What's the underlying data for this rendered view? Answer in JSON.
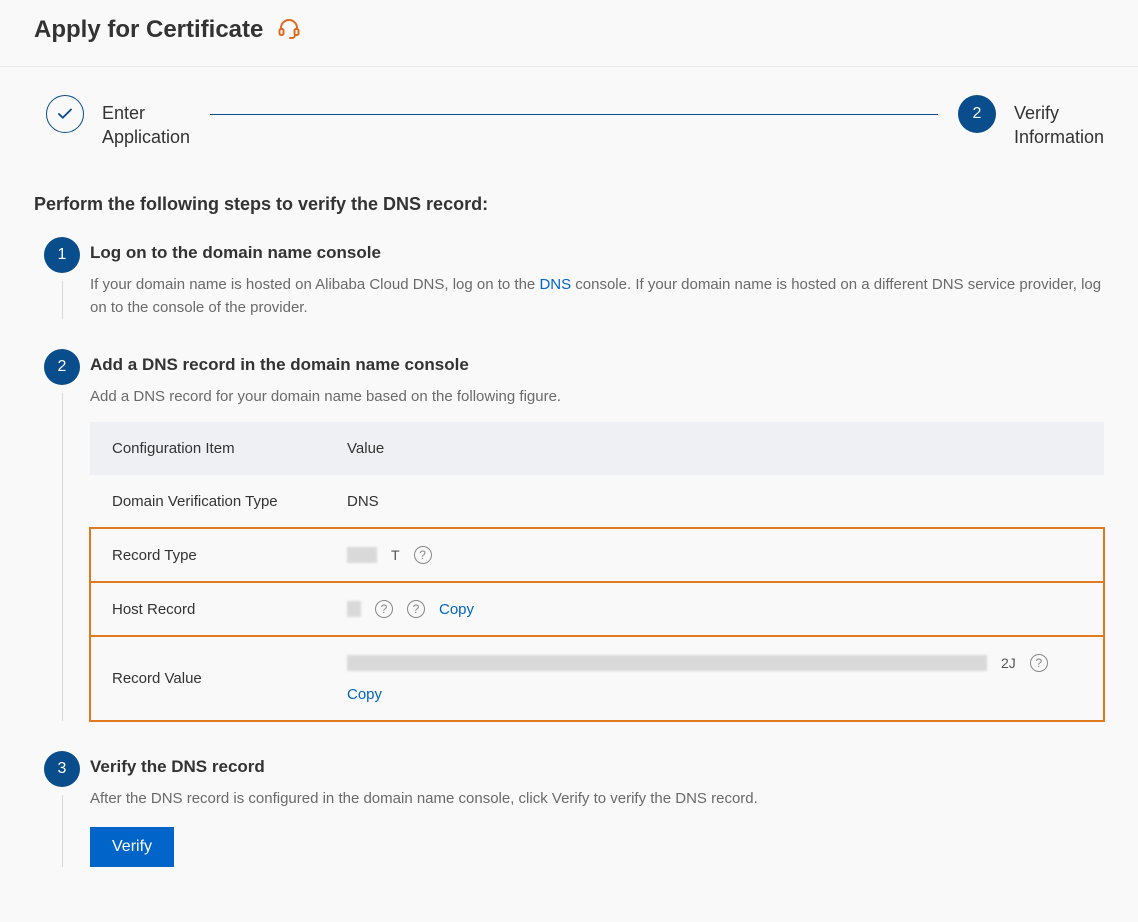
{
  "header": {
    "title": "Apply for Certificate"
  },
  "wizard": {
    "step1_label": "Enter\nApplication",
    "step2_label": "Verify\nInformation",
    "step2_number": "2"
  },
  "section_title": "Perform the following steps to verify the DNS record:",
  "steps": {
    "s1": {
      "n": "1",
      "title": "Log on to the domain name console",
      "desc_before": "If your domain name is hosted on Alibaba Cloud DNS, log on to the ",
      "link_text": "DNS",
      "desc_after": " console. If your domain name is hosted on a different DNS service provider, log on to the console of the provider."
    },
    "s2": {
      "n": "2",
      "title": "Add a DNS record in the domain name console",
      "desc": "Add a DNS record for your domain name based on the following figure."
    },
    "s3": {
      "n": "3",
      "title": "Verify the DNS record",
      "desc": "After the DNS record is configured in the domain name console, click Verify to verify the DNS record.",
      "button": "Verify"
    }
  },
  "table": {
    "header_item": "Configuration Item",
    "header_value": "Value",
    "rows": [
      {
        "label": "Domain Verification Type",
        "value": "DNS"
      },
      {
        "label": "Record Type",
        "value_suffix": "T"
      },
      {
        "label": "Host Record",
        "copy": "Copy"
      },
      {
        "label": "Record Value",
        "value_suffix": " 2J",
        "copy": "Copy"
      }
    ]
  },
  "labels": {
    "help": "?",
    "copy": "Copy"
  }
}
